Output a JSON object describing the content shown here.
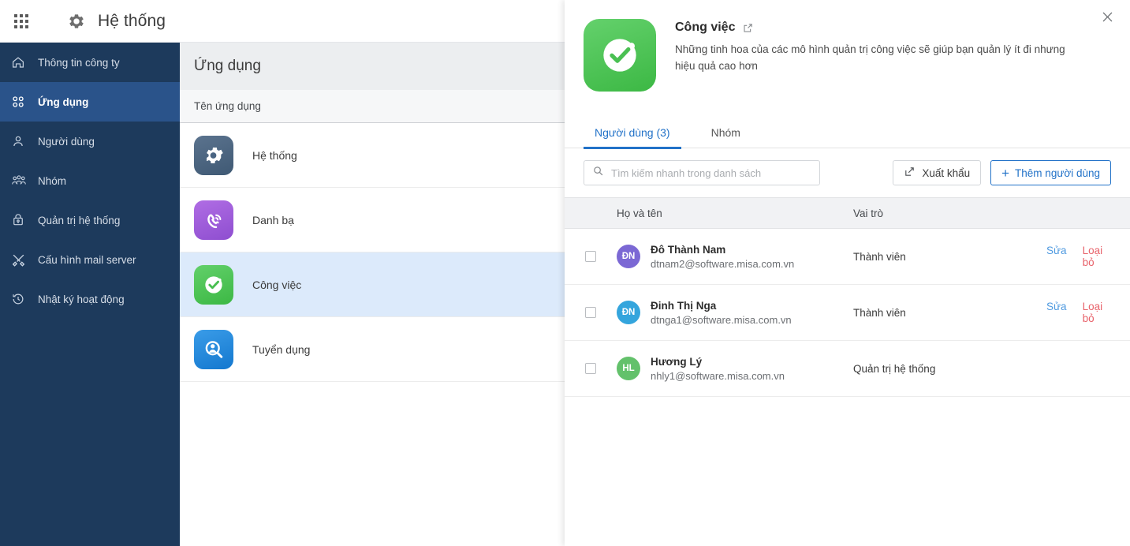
{
  "topbar": {
    "apps_icon": "grid-apps-icon",
    "gear_icon": "gear-icon",
    "title": "Hệ thống"
  },
  "sidebar": {
    "items": [
      {
        "label": "Thông tin công ty",
        "icon": "home-icon",
        "active": false
      },
      {
        "label": "Ứng dụng",
        "icon": "apps-grid-icon",
        "active": true
      },
      {
        "label": "Người dùng",
        "icon": "user-icon",
        "active": false
      },
      {
        "label": "Nhóm",
        "icon": "users-group-icon",
        "active": false
      },
      {
        "label": "Quản trị hệ thống",
        "icon": "admin-lock-icon",
        "active": false
      },
      {
        "label": "Cấu hình mail server",
        "icon": "tools-icon",
        "active": false
      },
      {
        "label": "Nhật ký hoạt động",
        "icon": "history-clock-icon",
        "active": false
      }
    ]
  },
  "middle": {
    "heading": "Ứng dụng",
    "column_header": "Tên ứng dụng",
    "apps": [
      {
        "name": "Hệ thống",
        "icon": "gear-app-icon",
        "color": "#4a6583",
        "selected": false
      },
      {
        "name": "Danh bạ",
        "icon": "phone-app-icon",
        "color": "#a259d9",
        "selected": false
      },
      {
        "name": "Công việc",
        "icon": "check-app-icon",
        "color": "#4cc252",
        "selected": true
      },
      {
        "name": "Tuyển dụng",
        "icon": "recruit-app-icon",
        "color": "#1f8ae0",
        "selected": false
      }
    ]
  },
  "panel": {
    "app_title": "Công việc",
    "external_link_icon": "external-link-icon",
    "close_icon": "close-icon",
    "app_icon": "check-app-icon",
    "app_icon_color": "#4cc252",
    "description": "Những tinh hoa của các mô hình quản trị công việc sẽ giúp bạn quản lý ít đi nhưng hiệu quả cao hơn",
    "tabs": [
      {
        "label": "Người dùng (3)",
        "active": true
      },
      {
        "label": "Nhóm",
        "active": false
      }
    ],
    "search": {
      "icon": "search-icon",
      "value": "",
      "placeholder": "Tìm kiếm nhanh trong danh sách"
    },
    "export_button": {
      "label": "Xuất khẩu",
      "icon": "export-icon"
    },
    "add_user_button": {
      "label": "Thêm người dùng",
      "icon": "plus-icon"
    },
    "cursor_icon": "hand-pointer-cursor",
    "table": {
      "headers": {
        "name": "Họ và tên",
        "role": "Vai trò"
      },
      "rows": [
        {
          "checked": false,
          "initials": "ĐN",
          "avatar_color": "#7b68d4",
          "name": "Đô Thành Nam",
          "email": "dtnam2@software.misa.com.vn",
          "role": "Thành viên",
          "edit_label": "Sửa",
          "remove_label": "Loại bỏ",
          "has_actions": true
        },
        {
          "checked": false,
          "initials": "ĐN",
          "avatar_color": "#34a5dd",
          "name": "Đinh Thị Nga",
          "email": "dtnga1@software.misa.com.vn",
          "role": "Thành viên",
          "edit_label": "Sửa",
          "remove_label": "Loại bỏ",
          "has_actions": true
        },
        {
          "checked": false,
          "initials": "HL",
          "avatar_color": "#63c16b",
          "name": "Hương Lý",
          "email": "nhly1@software.misa.com.vn",
          "role": "Quản trị hệ thống",
          "edit_label": "",
          "remove_label": "",
          "has_actions": false
        }
      ]
    }
  },
  "colors": {
    "sidebar_bg": "#1d3a5c",
    "sidebar_active": "#2a538a",
    "accent": "#2272c8",
    "row_selected": "#dceafb",
    "danger": "#e8636b"
  }
}
